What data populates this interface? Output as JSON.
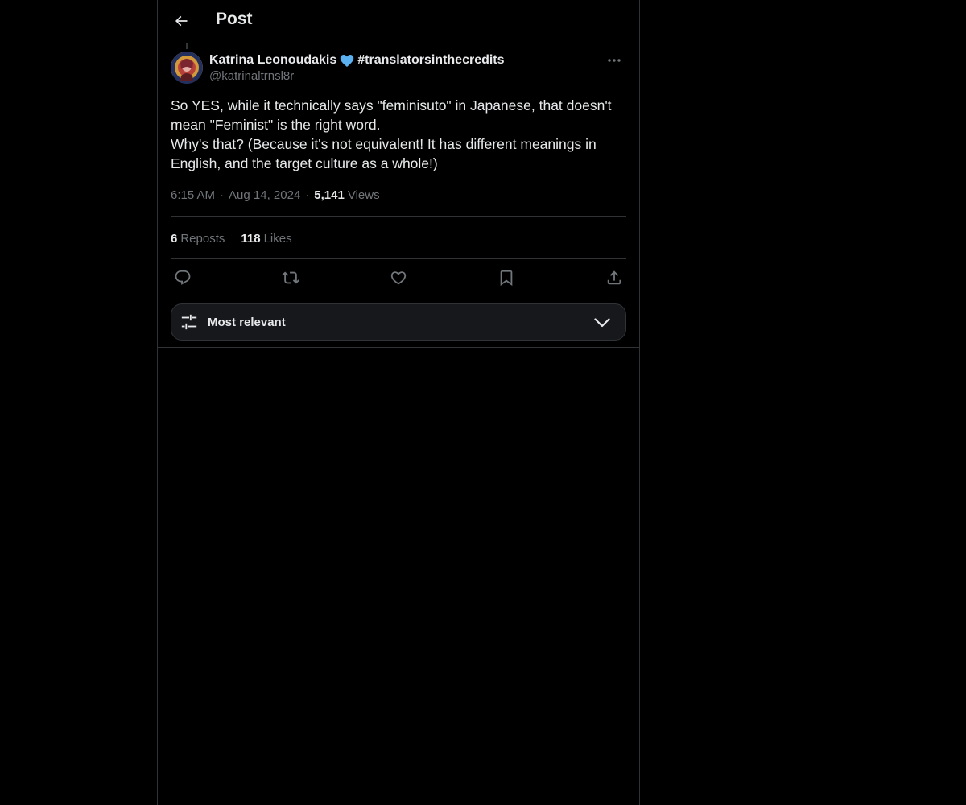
{
  "header": {
    "title": "Post"
  },
  "post": {
    "author": {
      "display_name": "Katrina Leonoudakis",
      "badge_icon": "blue-heart-icon",
      "hashtag": "#translatorsinthecredits",
      "handle": "@katrinaltrnsl8r"
    },
    "text": "So YES, while it technically says \"feminisuto\" in Japanese, that doesn't mean \"Feminist\" is the right word.\nWhy's that? (Because it's not equivalent! It has different meanings in English, and the target culture as a whole!)",
    "time": "6:15 AM",
    "date": "Aug 14, 2024",
    "views_count": "5,141",
    "views_label": "Views",
    "separator": "·"
  },
  "stats": {
    "reposts_count": "6",
    "reposts_label": "Reposts",
    "likes_count": "118",
    "likes_label": "Likes"
  },
  "actions": [
    "reply-icon",
    "repost-icon",
    "like-icon",
    "bookmark-icon",
    "share-icon"
  ],
  "sort": {
    "label": "Most relevant"
  },
  "colors": {
    "background": "#000000",
    "text_primary": "#e7e9ea",
    "text_secondary": "#71767b",
    "border": "#2f3336",
    "heart": "#5ab0f0"
  }
}
